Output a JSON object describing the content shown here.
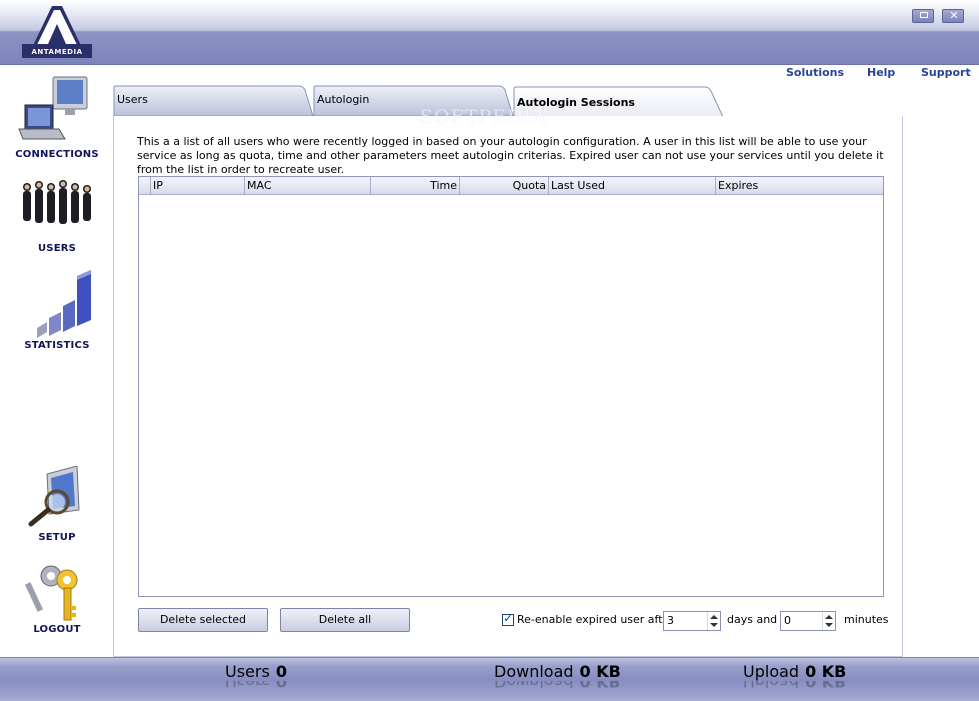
{
  "app": {
    "logo_text": "ANTAMEDIA",
    "watermark": "SOFTPEDIA"
  },
  "nav": {
    "connections": "CONNECTIONS",
    "users": "USERS",
    "statistics": "STATISTICS",
    "setup": "SETUP",
    "logout": "LOGOUT"
  },
  "links": {
    "solutions": "Solutions",
    "help": "Help",
    "support": "Support"
  },
  "tabs": [
    {
      "label": "Users",
      "active": false
    },
    {
      "label": "Autologin",
      "active": false
    },
    {
      "label": "Autologin Sessions",
      "active": true
    }
  ],
  "description": "This a a list of all users who were recently logged in based on your autologin configuration. A user in this list will be able to use your service as long as quota, time and other parameters meet autologin criterias. Expired user can not use your services until you delete it from the list in order to recreate user.",
  "table": {
    "columns": [
      "IP",
      "MAC",
      "Time",
      "Quota",
      "Last Used",
      "Expires"
    ],
    "rows": []
  },
  "controls": {
    "delete_selected": "Delete selected",
    "delete_all": "Delete all",
    "reenable_label": "Re-enable expired user after",
    "reenable_checked": true,
    "days_value": "3",
    "days_label": "days and",
    "minutes_value": "0",
    "minutes_label": "minutes"
  },
  "status": {
    "users_label": "Users",
    "users_value": "0",
    "download_label": "Download",
    "download_value": "0 KB",
    "upload_label": "Upload",
    "upload_value": "0 KB"
  },
  "colors": {
    "header": "#7c84bb",
    "link": "#2a4494",
    "nav_label": "#10135a"
  }
}
